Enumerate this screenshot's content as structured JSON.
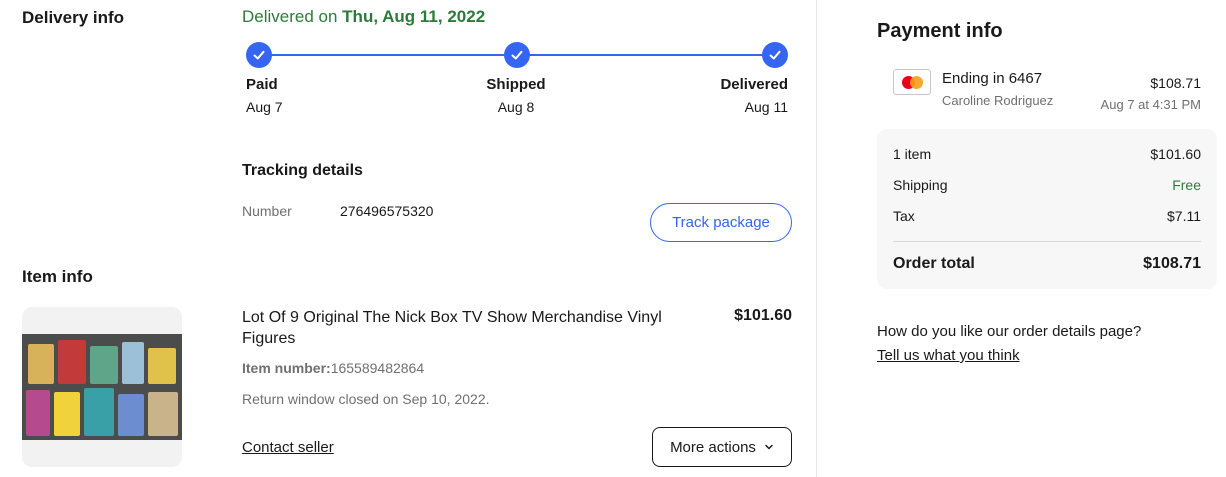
{
  "delivery": {
    "section_label": "Delivery info",
    "status_prefix": "Delivered on ",
    "status_date": "Thu, Aug 11, 2022",
    "steps": [
      {
        "label": "Paid",
        "date": "Aug 7"
      },
      {
        "label": "Shipped",
        "date": "Aug 8"
      },
      {
        "label": "Delivered",
        "date": "Aug 11"
      }
    ],
    "tracking_title": "Tracking details",
    "tracking_key": "Number",
    "tracking_number": "276496575320",
    "track_button": "Track package"
  },
  "item": {
    "section_label": "Item info",
    "title": "Lot Of 9 Original The Nick Box TV Show Merchandise Vinyl Figures",
    "price": "$101.60",
    "number_label": "Item number:",
    "number_value": "165589482864",
    "return_window": "Return window closed on Sep 10, 2022.",
    "contact_seller": "Contact seller",
    "more_actions": "More actions"
  },
  "payment": {
    "title": "Payment info",
    "card_ending": "Ending in 6467",
    "card_holder": "Caroline Rodriguez",
    "amount": "$108.71",
    "date": "Aug 7 at 4:31 PM",
    "summary": {
      "items_label": "1 item",
      "items_value": "$101.60",
      "shipping_label": "Shipping",
      "shipping_value": "Free",
      "tax_label": "Tax",
      "tax_value": "$7.11",
      "total_label": "Order total",
      "total_value": "$108.71"
    }
  },
  "feedback": {
    "question": "How do you like our order details page?",
    "link": "Tell us what you think"
  },
  "colors": {
    "accent_blue": "#3665f3",
    "success_green": "#2c7b3a",
    "muted_text": "#707070"
  }
}
